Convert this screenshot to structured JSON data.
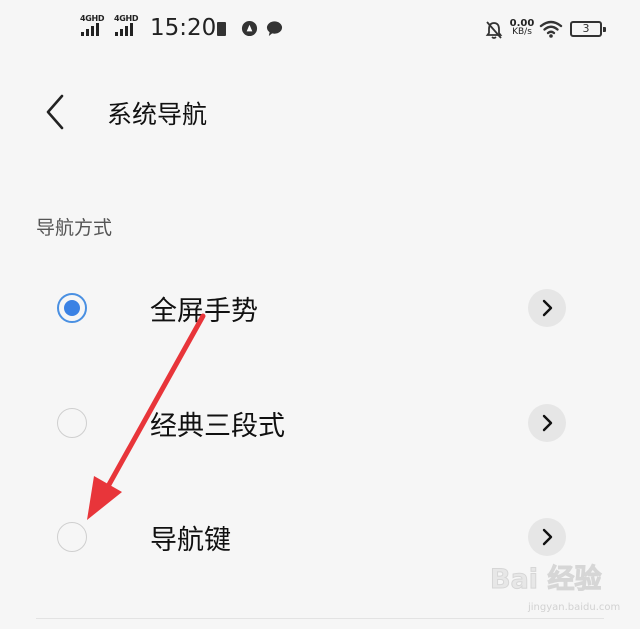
{
  "status_bar": {
    "net1": "4GHD",
    "net2": "4GHD",
    "time": "15:20",
    "speed_value": "0.00",
    "speed_unit": "KB/s",
    "battery": "3"
  },
  "header": {
    "title": "系统导航"
  },
  "section": {
    "title": "导航方式"
  },
  "options": [
    {
      "label": "全屏手势",
      "selected": true
    },
    {
      "label": "经典三段式",
      "selected": false
    },
    {
      "label": "导航键",
      "selected": false
    }
  ],
  "watermark": {
    "logo": "Bai 经验",
    "url": "jingyan.baidu.com"
  },
  "colors": {
    "accent": "#3b82e4",
    "annotation_arrow": "#e8353a"
  }
}
